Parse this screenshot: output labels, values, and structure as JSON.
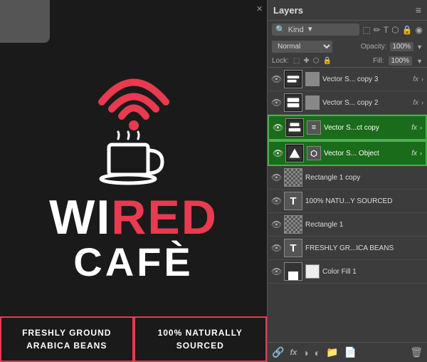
{
  "left": {
    "brand": {
      "wi": "WI",
      "red": "RED",
      "cafe": "CAFÈ"
    },
    "bottom_boxes": [
      {
        "text": "FRESHLY GROUND\nARABICA BEANS"
      },
      {
        "text": "100% NATURALLY\nSOURCED"
      }
    ]
  },
  "layers_panel": {
    "title": "Layers",
    "menu_icon": "≡",
    "search_label": "Kind",
    "blend_mode": "Normal",
    "opacity_label": "Opacity:",
    "opacity_value": "100%",
    "lock_label": "Lock:",
    "fill_label": "Fill:",
    "fill_value": "100%",
    "layers": [
      {
        "name": "Vector S... copy 3",
        "has_fx": true,
        "highlighted": false,
        "visible": true,
        "thumb_type": "vector"
      },
      {
        "name": "Vector S... copy 2",
        "has_fx": true,
        "highlighted": false,
        "visible": true,
        "thumb_type": "vector"
      },
      {
        "name": "Vector S...ct copy",
        "has_fx": true,
        "highlighted": true,
        "visible": true,
        "thumb_type": "vector"
      },
      {
        "name": "Vector S... Object",
        "has_fx": true,
        "highlighted": true,
        "visible": true,
        "thumb_type": "vector"
      },
      {
        "name": "Rectangle 1 copy",
        "has_fx": false,
        "highlighted": false,
        "visible": true,
        "thumb_type": "rect"
      },
      {
        "name": "100% NATU...Y SOURCED",
        "has_fx": false,
        "highlighted": false,
        "visible": true,
        "thumb_type": "text"
      },
      {
        "name": "Rectangle 1",
        "has_fx": false,
        "highlighted": false,
        "visible": true,
        "thumb_type": "rect"
      },
      {
        "name": "FRESHLY GR...ICA BEANS",
        "has_fx": false,
        "highlighted": false,
        "visible": true,
        "thumb_type": "text"
      },
      {
        "name": "Color Fill 1",
        "has_fx": false,
        "highlighted": false,
        "visible": true,
        "thumb_type": "fill"
      }
    ],
    "footer_icons": [
      "🔗",
      "fx",
      "◑",
      "📁",
      "🗑"
    ]
  }
}
